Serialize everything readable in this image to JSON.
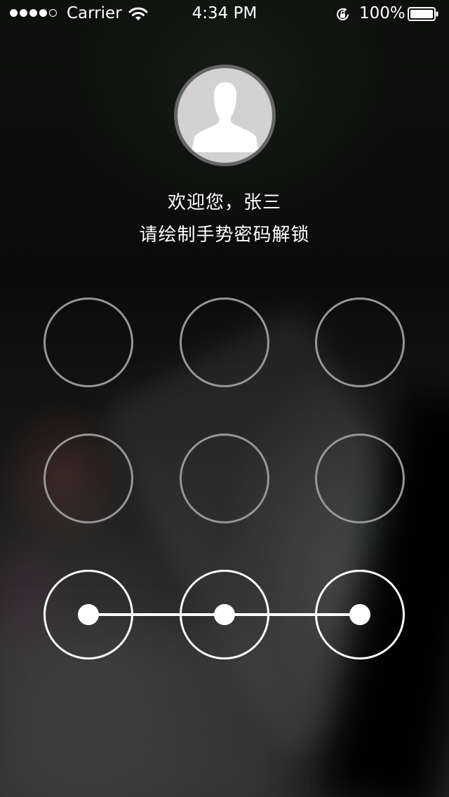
{
  "status_bar": {
    "carrier": "Carrier",
    "time": "4:34 PM",
    "battery_percent": "100%",
    "signal_strength": 4,
    "signal_max": 5,
    "icons": [
      "wifi-icon",
      "rotation-lock-icon",
      "battery-icon"
    ]
  },
  "profile": {
    "avatar_icon": "user-silhouette-icon"
  },
  "messages": {
    "welcome": "欢迎您，张三",
    "instruction": "请绘制手势密码解锁"
  },
  "pattern_lock": {
    "rows": 3,
    "cols": 3,
    "selected_nodes": [
      7,
      8,
      9
    ],
    "active_color": "#ffffff",
    "inactive_color": "#969696"
  }
}
